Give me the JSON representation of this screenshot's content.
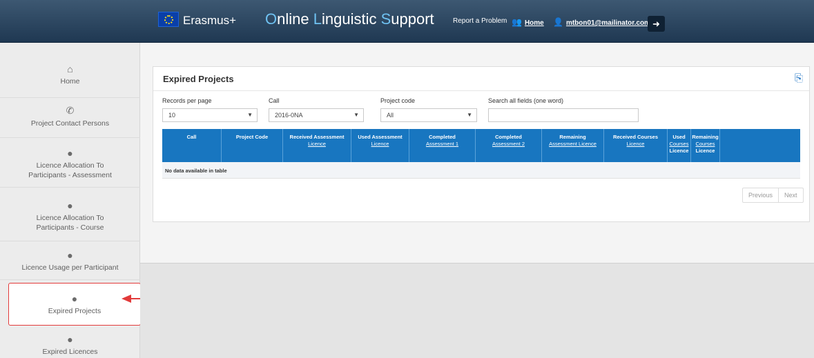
{
  "header": {
    "brand": "Erasmus+",
    "product": {
      "p1": "O",
      "p2": "nline ",
      "p3": "L",
      "p4": "inguistic ",
      "p5": "S",
      "p6": "upport"
    },
    "report_link": "Report a Problem",
    "home_link": "Home",
    "user_link": "mtbon01@mailinator.com",
    "colors": {
      "bar": "#2c465f",
      "highlight": "#6fc2f2"
    }
  },
  "sidebar": {
    "items": [
      {
        "label": "Home",
        "icon": "house-icon"
      },
      {
        "label": "Project Contact Persons",
        "icon": "phone-icon"
      },
      {
        "label": "Licence Allocation To",
        "label2": "Participants - Assessment",
        "icon": "pin-icon"
      },
      {
        "label": "Licence Allocation To",
        "label2": "Participants - Course",
        "icon": "pin-icon"
      },
      {
        "label": "Licence Usage per Participant",
        "icon": "pin-icon"
      },
      {
        "label": "Expired Projects",
        "icon": "pin-icon",
        "active": true
      },
      {
        "label": "Expired Licences",
        "icon": "pin-icon"
      }
    ]
  },
  "panel": {
    "title": "Expired Projects",
    "filters": {
      "records_label": "Records per page",
      "records_value": "10",
      "call_label": "Call",
      "call_value": "2016-0NA",
      "project_label": "Project code",
      "project_value": "All",
      "search_label": "Search all fields (one word)",
      "search_value": ""
    },
    "table": {
      "columns": [
        {
          "h1": "Call",
          "h2": ""
        },
        {
          "h1": "Project Code",
          "h2": ""
        },
        {
          "h1": "Received Assessment",
          "h2": "Licence"
        },
        {
          "h1": "Used Assessment",
          "h2": "Licence"
        },
        {
          "h1": "Completed",
          "h2": "Assessment 1"
        },
        {
          "h1": "Completed",
          "h2": "Assessment 2"
        },
        {
          "h1": "Remaining",
          "h2": "Assessment Licence"
        },
        {
          "h1": "Received Courses",
          "h2": "Licence"
        },
        {
          "h1": "Used",
          "h2": "Courses",
          "h3": "Licence"
        },
        {
          "h1": "Remaining",
          "h2": "Courses",
          "h3": "Licence"
        }
      ],
      "empty_text": "No data available in table"
    },
    "pager": {
      "previous": "Previous",
      "next": "Next"
    },
    "accent": "#1876c0"
  }
}
